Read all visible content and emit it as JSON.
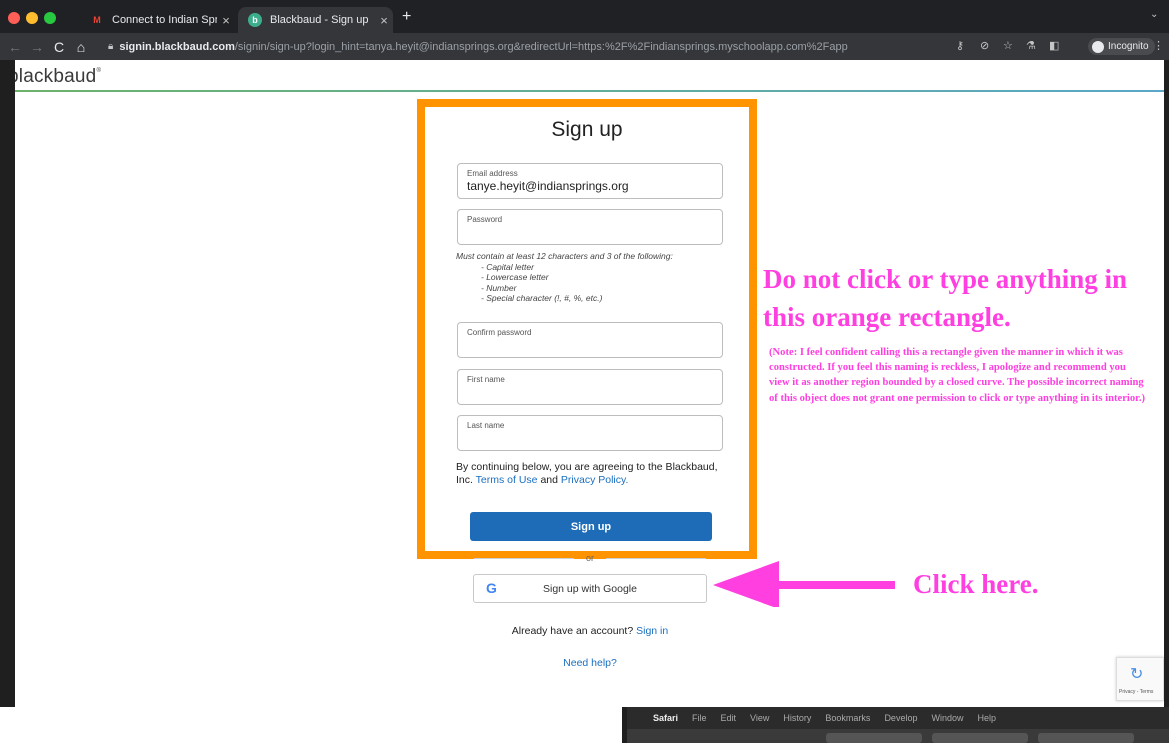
{
  "browser": {
    "tabs": [
      {
        "title": "Connect to Indian Springs Scho",
        "icon": "gmail-icon"
      },
      {
        "title": "Blackbaud - Sign up",
        "icon": "blackbaud-icon"
      }
    ],
    "url_host": "signin.blackbaud.com",
    "url_rest": "/signin/sign-up?login_hint=tanya.heyit@indiansprings.org&redirectUrl=https:%2F%2Findiansprings.myschoolapp.com%2Fapp",
    "incognito_label": "Incognito"
  },
  "brand": {
    "logo_text": "blackbaud"
  },
  "form": {
    "title": "Sign up",
    "email_label": "Email address",
    "email_value": "tanye.heyit@indiansprings.org",
    "password_label": "Password",
    "password_rules_heading": "Must contain at least 12 characters and 3 of the following:",
    "password_rules": [
      "- Capital letter",
      "- Lowercase letter",
      "- Number",
      "- Special character (!, #, %, etc.)"
    ],
    "confirm_label": "Confirm password",
    "first_name_label": "First name",
    "last_name_label": "Last name",
    "agree_prefix": "By continuing below, you are agreeing to the Blackbaud, Inc.",
    "terms_link": "Terms of Use",
    "and_text": "and",
    "privacy_link": "Privacy Policy.",
    "submit_label": "Sign up",
    "or_text": "or",
    "google_label": "Sign up with Google",
    "have_account_text": "Already have an account?",
    "sign_in_link": "Sign in",
    "need_help": "Need help?"
  },
  "annotations": {
    "main": "Do not click or type anything in this orange rectangle.",
    "note": "(Note: I feel confident calling this a rectangle given the manner in which it was constructed. If you feel this naming is reckless, I apologize and recommend you view it as another region bounded by a closed curve. The possible incorrect naming of this object does not grant one permission to click or type anything in its interior.)",
    "click_here": "Click here."
  },
  "recaptcha": {
    "text": "Privacy - Terms"
  },
  "safari_menu": [
    "Safari",
    "File",
    "Edit",
    "View",
    "History",
    "Bookmarks",
    "Develop",
    "Window",
    "Help"
  ],
  "colors": {
    "orange": "#ff9400",
    "magenta": "#ff3fe0",
    "primary_button": "#1e6cb7"
  }
}
